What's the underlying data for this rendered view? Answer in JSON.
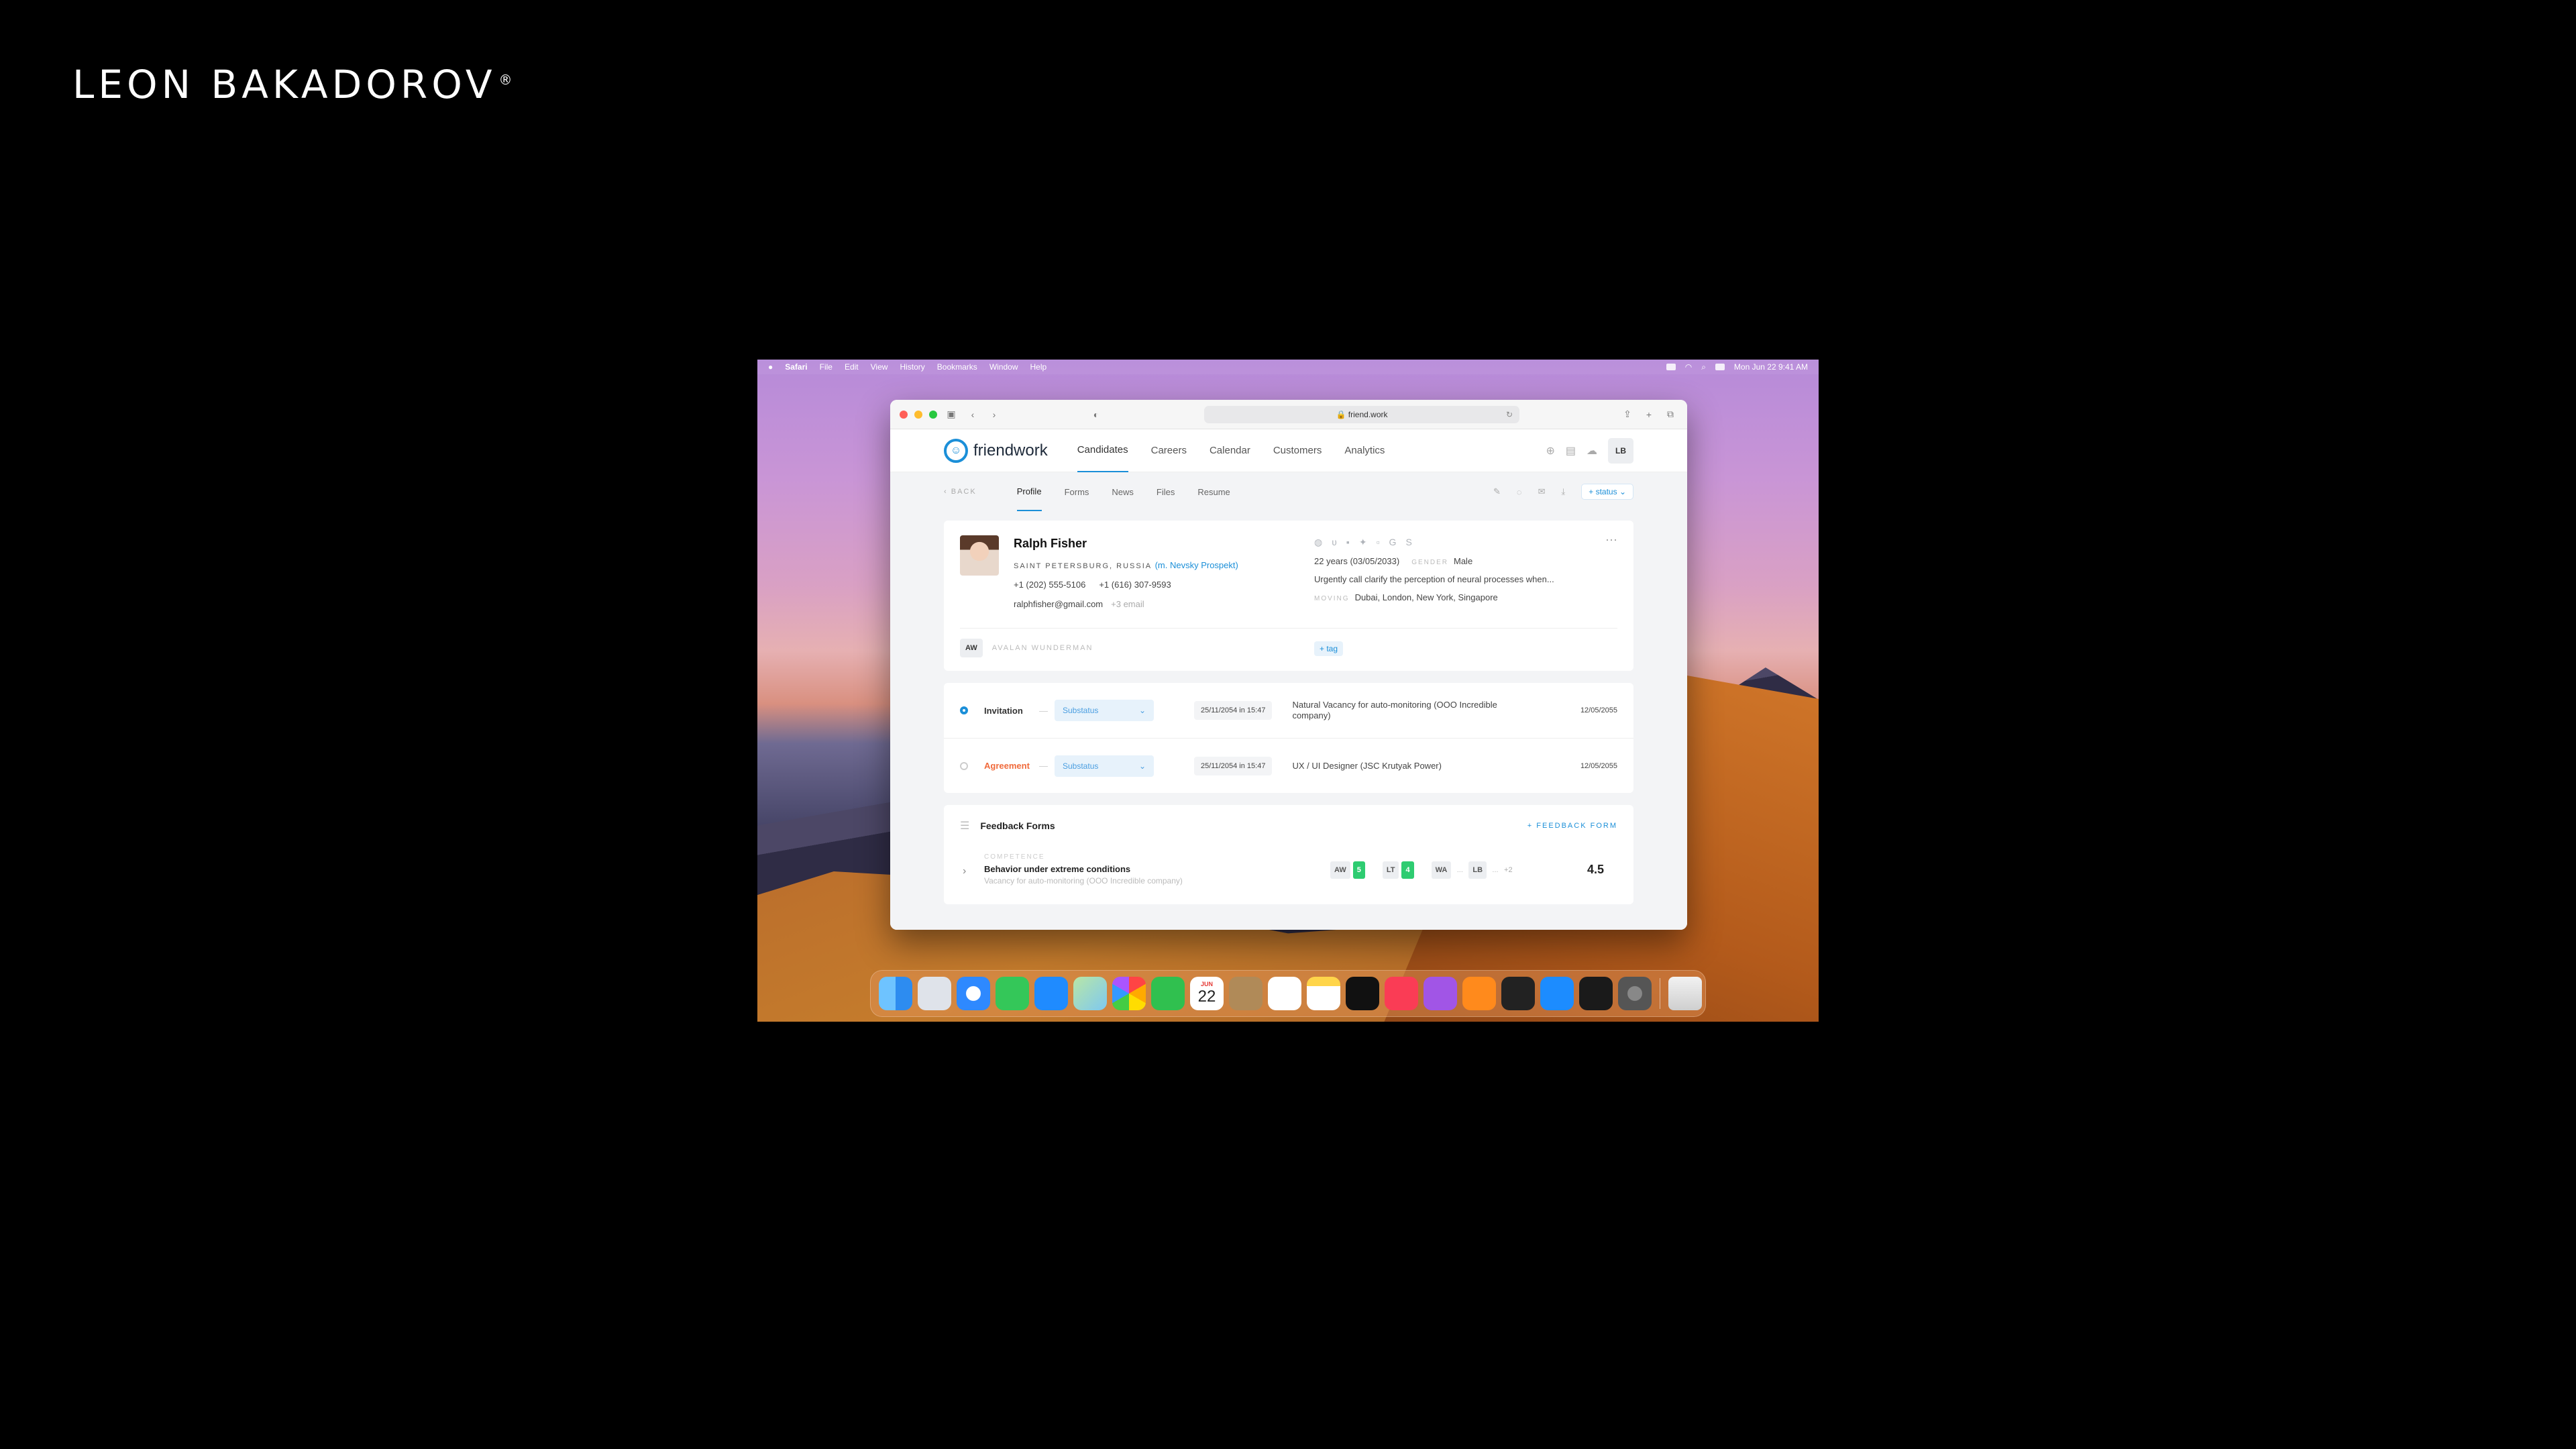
{
  "brand": "LEON BAKADOROV",
  "brand_mark": "®",
  "menubar": {
    "apple": "",
    "app": "Safari",
    "items": [
      "File",
      "Edit",
      "View",
      "History",
      "Bookmarks",
      "Window",
      "Help"
    ],
    "datetime": "Mon Jun 22  9:41 AM"
  },
  "safari": {
    "url": "friend.work"
  },
  "app": {
    "logo_text": "friendwork",
    "nav": [
      "Candidates",
      "Careers",
      "Calendar",
      "Customers",
      "Analytics"
    ],
    "user_initials": "LB"
  },
  "subnav": {
    "back": "BACK",
    "tabs": [
      "Profile",
      "Forms",
      "News",
      "Files",
      "Resume"
    ],
    "status_button": "+ status"
  },
  "profile": {
    "name": "Ralph Fisher",
    "location": "SAINT PETERSBURG, RUSSIA",
    "metro": "(m. Nevsky Prospekt)",
    "phone1": "+1 (202) 555-5106",
    "phone2": "+1 (616) 307-9593",
    "email": "ralphfisher@gmail.com",
    "more_emails": "+3 email",
    "age": "22 years (03/05/2033)",
    "gender_label": "GENDER",
    "gender": "Male",
    "note": "Urgently call clarify the perception of neural processes when...",
    "moving_label": "MOVING",
    "moving": "Dubai, London, New York, Singapore",
    "owner_initials": "AW",
    "owner_name": "AVALAN WUNDERMAN",
    "tag_button": "+ tag"
  },
  "stages": [
    {
      "name": "Invitation",
      "substatus": "Substatus",
      "date": "25/11/2054 in 15:47",
      "vacancy": "Natural Vacancy for auto-monitoring (OOO Incredible company)",
      "end_date": "12/05/2055",
      "active": true,
      "color": "#333333"
    },
    {
      "name": "Agreement",
      "substatus": "Substatus",
      "date": "25/11/2054 in 15:47",
      "vacancy": "UX / UI Designer (JSC Krutyak Power)",
      "end_date": "12/05/2055",
      "active": false,
      "color": "#f06a3b"
    }
  ],
  "feedback": {
    "title": "Feedback Forms",
    "add_button": "+ FEEDBACK FORM",
    "row": {
      "category": "COMPETENCE",
      "name": "Behavior under extreme conditions",
      "vacancy": "Vacancy for auto-monitoring (OOO Incredible company)",
      "scores": [
        {
          "who": "AW",
          "score": "5"
        },
        {
          "who": "LT",
          "score": "4"
        },
        {
          "who": "WA",
          "score": "..."
        },
        {
          "who": "LB",
          "score": "..."
        }
      ],
      "extra": "+2",
      "average": "4.5"
    }
  },
  "dock": {
    "calendar_month": "JUN",
    "calendar_day": "22",
    "apps": [
      "finder",
      "launchpad",
      "safari",
      "messages",
      "mail",
      "maps",
      "photos",
      "facetime",
      "calendar",
      "contacts",
      "reminders",
      "notes",
      "tv",
      "music",
      "podcasts",
      "books",
      "voice-memos",
      "app-store",
      "terminal",
      "system-preferences",
      "trash"
    ]
  },
  "colors": {
    "accent": "#1b8fd8",
    "score_green": "#2ecc71",
    "agreement": "#f06a3b"
  }
}
